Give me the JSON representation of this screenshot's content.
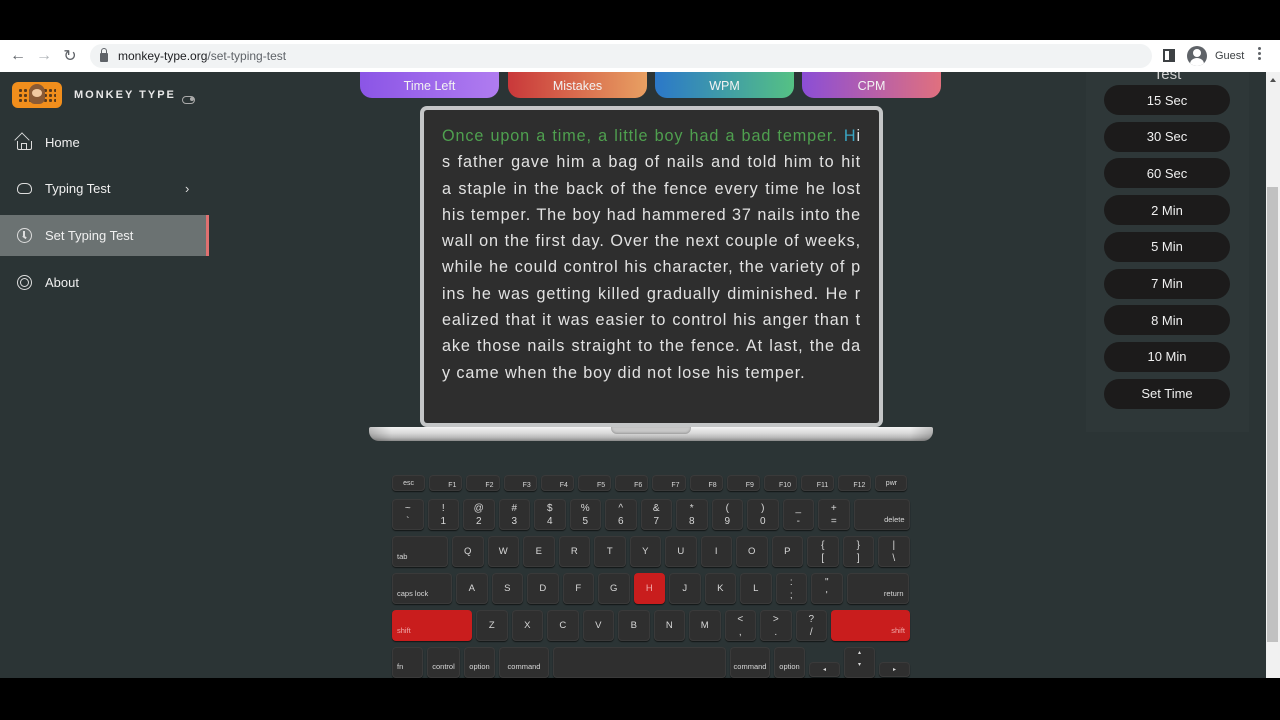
{
  "browser": {
    "url_host": "monkey-type.org",
    "url_path": "/set-typing-test",
    "profile_label": "Guest",
    "icons": [
      "back-arrow-icon",
      "forward-arrow-icon",
      "reload-icon",
      "lock-icon",
      "side-panel-icon",
      "avatar-icon",
      "kebab-menu-icon"
    ]
  },
  "sidebar": {
    "brand": "MONKEY TYPE",
    "items": [
      {
        "label": "Home",
        "icon": "home-icon",
        "active": false
      },
      {
        "label": "Typing Test",
        "icon": "github-icon",
        "active": false,
        "has_submenu": true
      },
      {
        "label": "Set Typing Test",
        "icon": "clock-icon",
        "active": true
      },
      {
        "label": "About",
        "icon": "target-icon",
        "active": false
      }
    ],
    "chevron": "›"
  },
  "stats": {
    "time_left": "Time Left",
    "mistakes": "Mistakes",
    "wpm": "WPM",
    "cpm": "CPM"
  },
  "typing": {
    "typed_text": "Once upon a time, a little boy had a bad temper. ",
    "current_char": "H",
    "remaining_text": "is father gave him a bag of nails and told him to hit a staple in the back of the fence every time he lost his temper. The boy had hammered 37 nails into the wall on the first day. Over the next couple of weeks, while he could control his character, the variety of pins he was getting killed gradually diminished. He realized that it was easier to control his anger than take those nails straight to the fence. At last, the day came when the boy did not lose his temper.",
    "colors": {
      "typed": "#4fa04f",
      "cursor": "#3aa6c4",
      "pending": "#e2e2e2"
    }
  },
  "keyboard": {
    "pressed_keys": [
      "H",
      "shift-left",
      "shift-right"
    ],
    "pressed_color": "#c91d1d",
    "row_fn": [
      "esc",
      "F1",
      "F2",
      "F3",
      "F4",
      "F5",
      "F6",
      "F7",
      "F8",
      "F9",
      "F10",
      "F11",
      "F12",
      "pwr"
    ],
    "row_num": [
      {
        "top": "~",
        "bottom": "`"
      },
      {
        "top": "!",
        "bottom": "1"
      },
      {
        "top": "@",
        "bottom": "2"
      },
      {
        "top": "#",
        "bottom": "3"
      },
      {
        "top": "$",
        "bottom": "4"
      },
      {
        "top": "%",
        "bottom": "5"
      },
      {
        "top": "^",
        "bottom": "6"
      },
      {
        "top": "&",
        "bottom": "7"
      },
      {
        "top": "*",
        "bottom": "8"
      },
      {
        "top": "(",
        "bottom": "9"
      },
      {
        "top": ")",
        "bottom": "0"
      },
      {
        "top": "_",
        "bottom": "-"
      },
      {
        "top": "+",
        "bottom": "="
      }
    ],
    "delete": "delete",
    "tab": "tab",
    "row_q": [
      "Q",
      "W",
      "E",
      "R",
      "T",
      "Y",
      "U",
      "I",
      "O",
      "P"
    ],
    "row_q_sym": [
      {
        "top": "{",
        "bottom": "["
      },
      {
        "top": "}",
        "bottom": "]"
      },
      {
        "top": "|",
        "bottom": "\\"
      }
    ],
    "caps": "caps lock",
    "row_a": [
      "A",
      "S",
      "D",
      "F",
      "G",
      "H",
      "J",
      "K",
      "L"
    ],
    "row_a_sym": [
      {
        "top": ":",
        "bottom": ";"
      },
      {
        "top": "\"",
        "bottom": "'"
      }
    ],
    "return": "return",
    "shift": "shift",
    "row_z": [
      "Z",
      "X",
      "C",
      "V",
      "B",
      "N",
      "M"
    ],
    "row_z_sym": [
      {
        "top": "<",
        "bottom": ","
      },
      {
        "top": ">",
        "bottom": "."
      },
      {
        "top": "?",
        "bottom": "/"
      }
    ],
    "bottom": {
      "fn": "fn",
      "control": "control",
      "option": "option",
      "command": "command",
      "left": "◂",
      "up": "▴",
      "down": "▾",
      "right": "▸"
    }
  },
  "right_panel": {
    "title": "Test",
    "options": [
      "15 Sec",
      "30 Sec",
      "60 Sec",
      "2 Min",
      "5 Min",
      "7 Min",
      "8 Min",
      "10 Min",
      "Set Time"
    ]
  }
}
